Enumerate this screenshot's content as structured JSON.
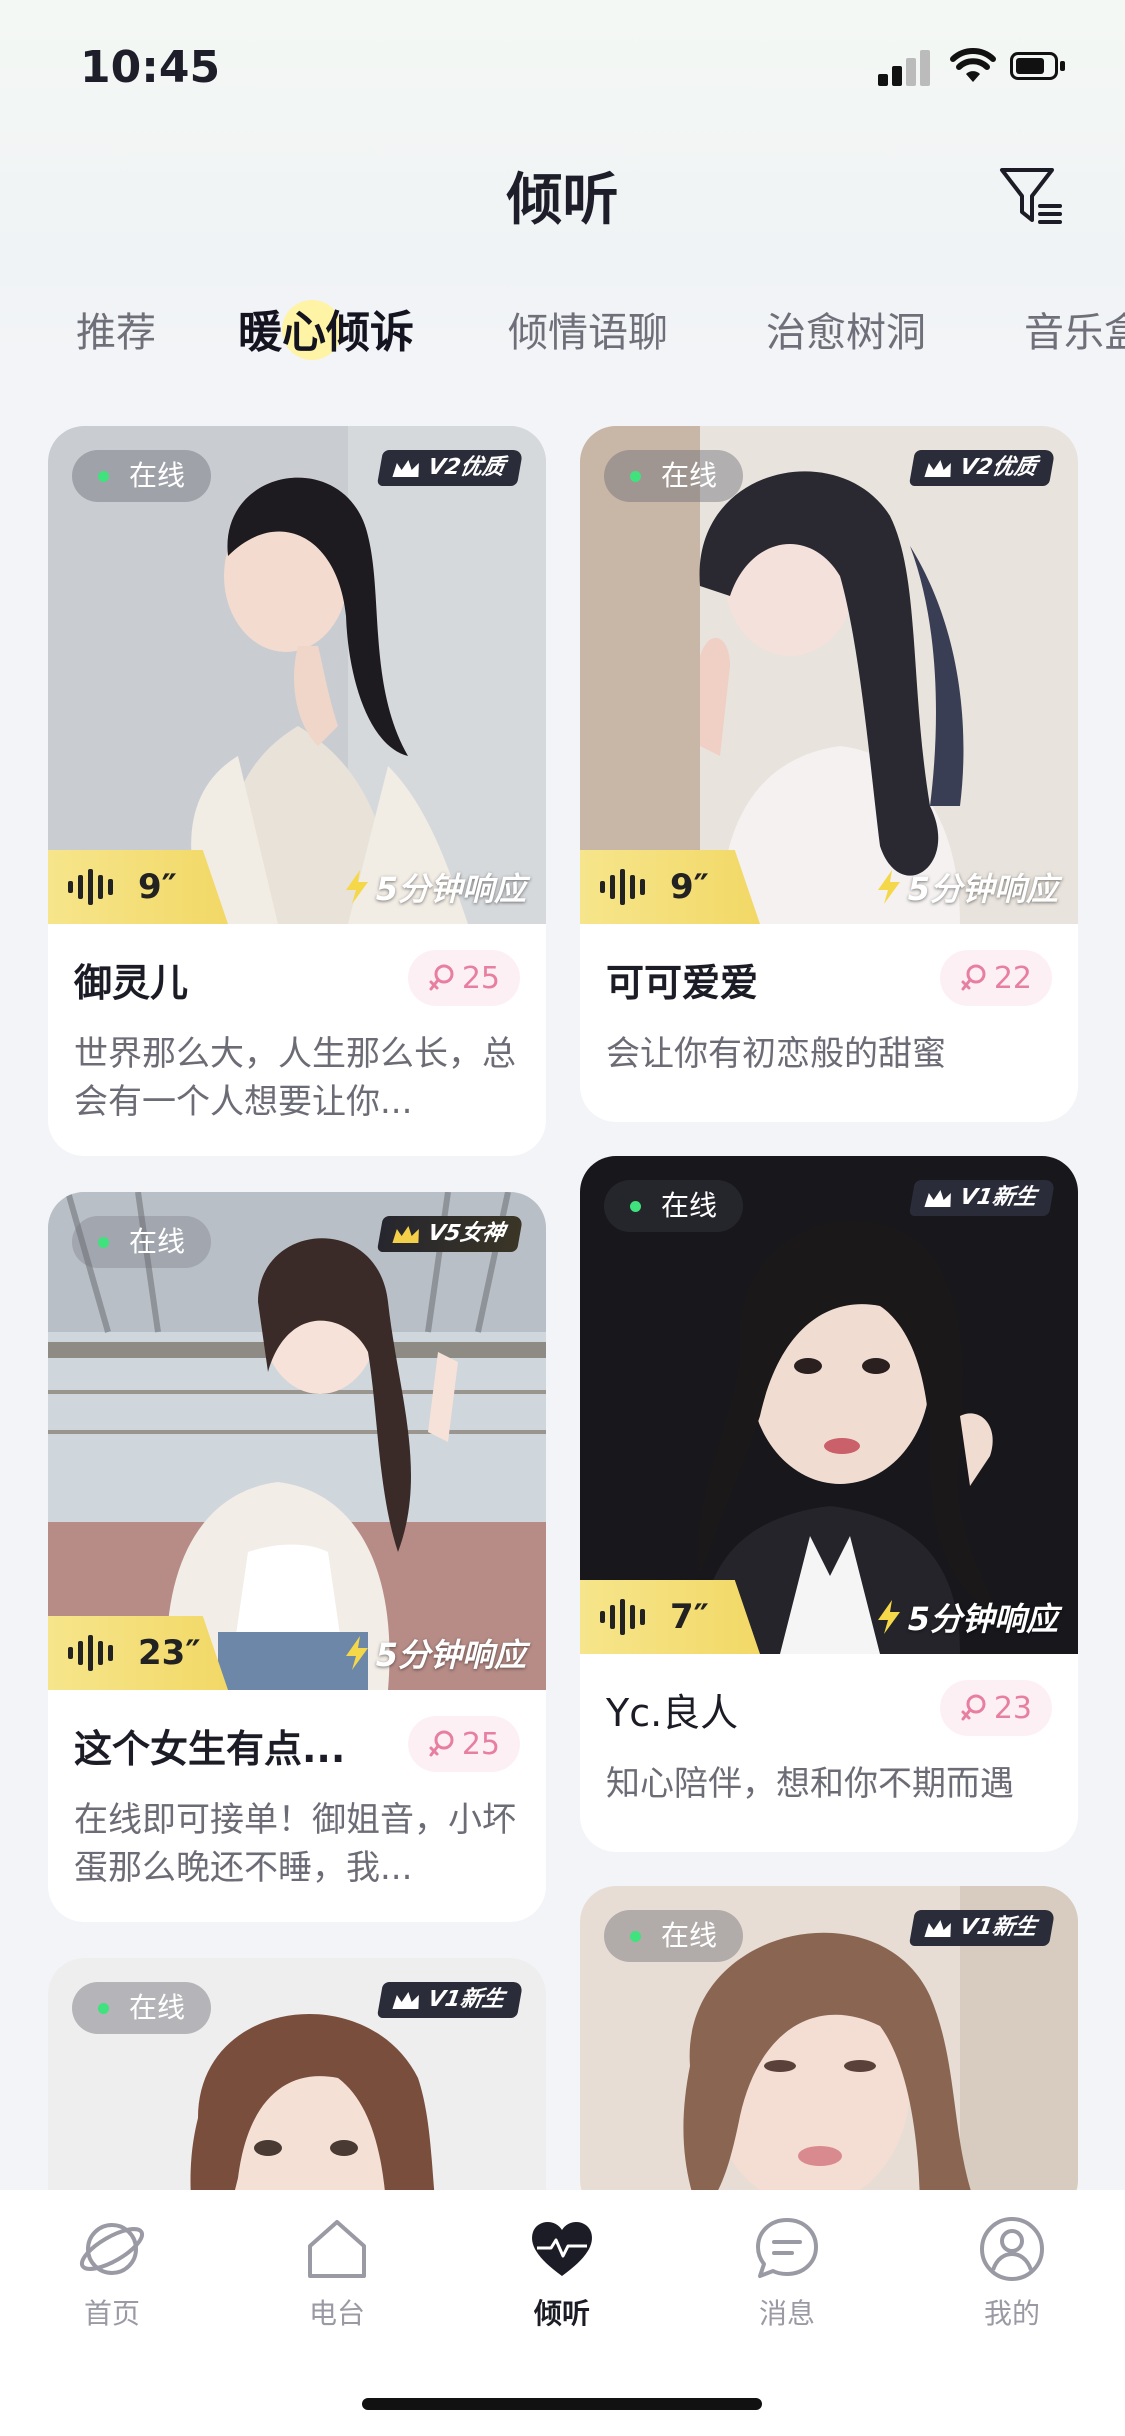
{
  "status_bar": {
    "time": "10:45"
  },
  "header": {
    "title": "倾听",
    "filter_icon": "filter-icon"
  },
  "tabs": [
    {
      "label": "推荐",
      "active": false
    },
    {
      "label": "暖心倾诉",
      "active": true
    },
    {
      "label": "倾情语聊",
      "active": false
    },
    {
      "label": "治愈树洞",
      "active": false
    },
    {
      "label": "音乐盒",
      "active": false
    }
  ],
  "cards": [
    {
      "status": "在线",
      "level": "V2优质",
      "voice_duration": "9″",
      "response": "5分钟响应",
      "name": "御灵儿",
      "likes": "25",
      "desc": "世界那么大，人生那么长，总会有一个人想要让你..."
    },
    {
      "status": "在线",
      "level": "V2优质",
      "voice_duration": "9″",
      "response": "5分钟响应",
      "name": "可可爱爱",
      "likes": "22",
      "desc": "会让你有初恋般的甜蜜"
    },
    {
      "status": "在线",
      "level": "V5女神",
      "voice_duration": "23″",
      "response": "5分钟响应",
      "name": "这个女生有点...",
      "likes": "25",
      "desc": "在线即可接单！御姐音，小坏蛋那么晚还不睡，我..."
    },
    {
      "status": "在线",
      "level": "V1新生",
      "voice_duration": "7″",
      "response": "5分钟响应",
      "name": "Yc.良人",
      "likes": "23",
      "desc": "知心陪伴，想和你不期而遇"
    },
    {
      "status": "在线",
      "level": "V1新生"
    },
    {
      "status": "在线",
      "level": "V1新生"
    }
  ],
  "bottom_nav": [
    {
      "label": "首页",
      "icon": "planet-icon",
      "active": false
    },
    {
      "label": "电台",
      "icon": "house-icon",
      "active": false
    },
    {
      "label": "倾听",
      "icon": "heart-pulse-icon",
      "active": true
    },
    {
      "label": "消息",
      "icon": "chat-bubble-icon",
      "active": false
    },
    {
      "label": "我的",
      "icon": "user-icon",
      "active": false
    }
  ],
  "colors": {
    "accent_yellow": "#f2d866",
    "online_green": "#3fe27c",
    "likes_pink": "#e77fa1"
  }
}
